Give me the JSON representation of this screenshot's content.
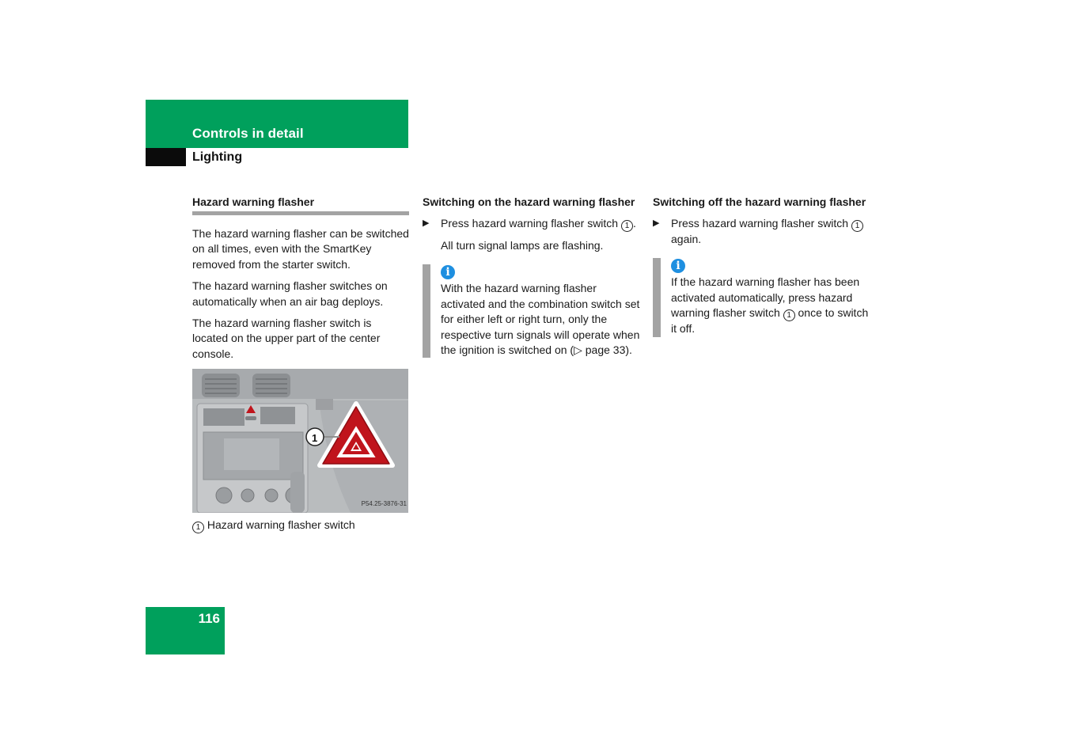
{
  "header": {
    "section": "Controls in detail",
    "subsection": "Lighting"
  },
  "column1": {
    "heading": "Hazard warning flasher",
    "paragraphs": [
      "The hazard warning flasher can be switched on all times, even with the SmartKey removed from the starter switch.",
      "The hazard warning flasher switches on automatically when an air bag deploys.",
      "The hazard warning flasher switch is located on the upper part of the center console."
    ],
    "figure": {
      "callout": "1",
      "image_code": "P54.25-3876-31"
    },
    "caption": {
      "number": "1",
      "text": "Hazard warning flasher switch"
    }
  },
  "column2": {
    "heading": "Switching on the hazard warning flasher",
    "step": {
      "text_before": "Press hazard warning flasher switch ",
      "ref": "1",
      "text_after": "."
    },
    "result": "All turn signal lamps are flashing.",
    "info": {
      "icon": "info-icon",
      "text": "With the hazard warning flasher activated and the combination switch set for either left or right turn, only the respective turn signals will operate when the ignition is switched on (▷ page 33)."
    }
  },
  "column3": {
    "heading": "Switching off the hazard warning flasher",
    "step": {
      "text_before": "Press hazard warning flasher switch ",
      "ref": "1",
      "text_after": " again."
    },
    "info": {
      "icon": "info-icon",
      "text_before": "If the hazard warning flasher has been activated automatically, press hazard warning flasher switch ",
      "ref": "1",
      "text_after": " once to switch it off."
    }
  },
  "footer": {
    "page_number": "116"
  },
  "colors": {
    "brand_green": "#00a05c",
    "info_blue": "#1e8fe0",
    "rule_gray": "#a3a3a3",
    "hazard_red": "#c0141c"
  }
}
